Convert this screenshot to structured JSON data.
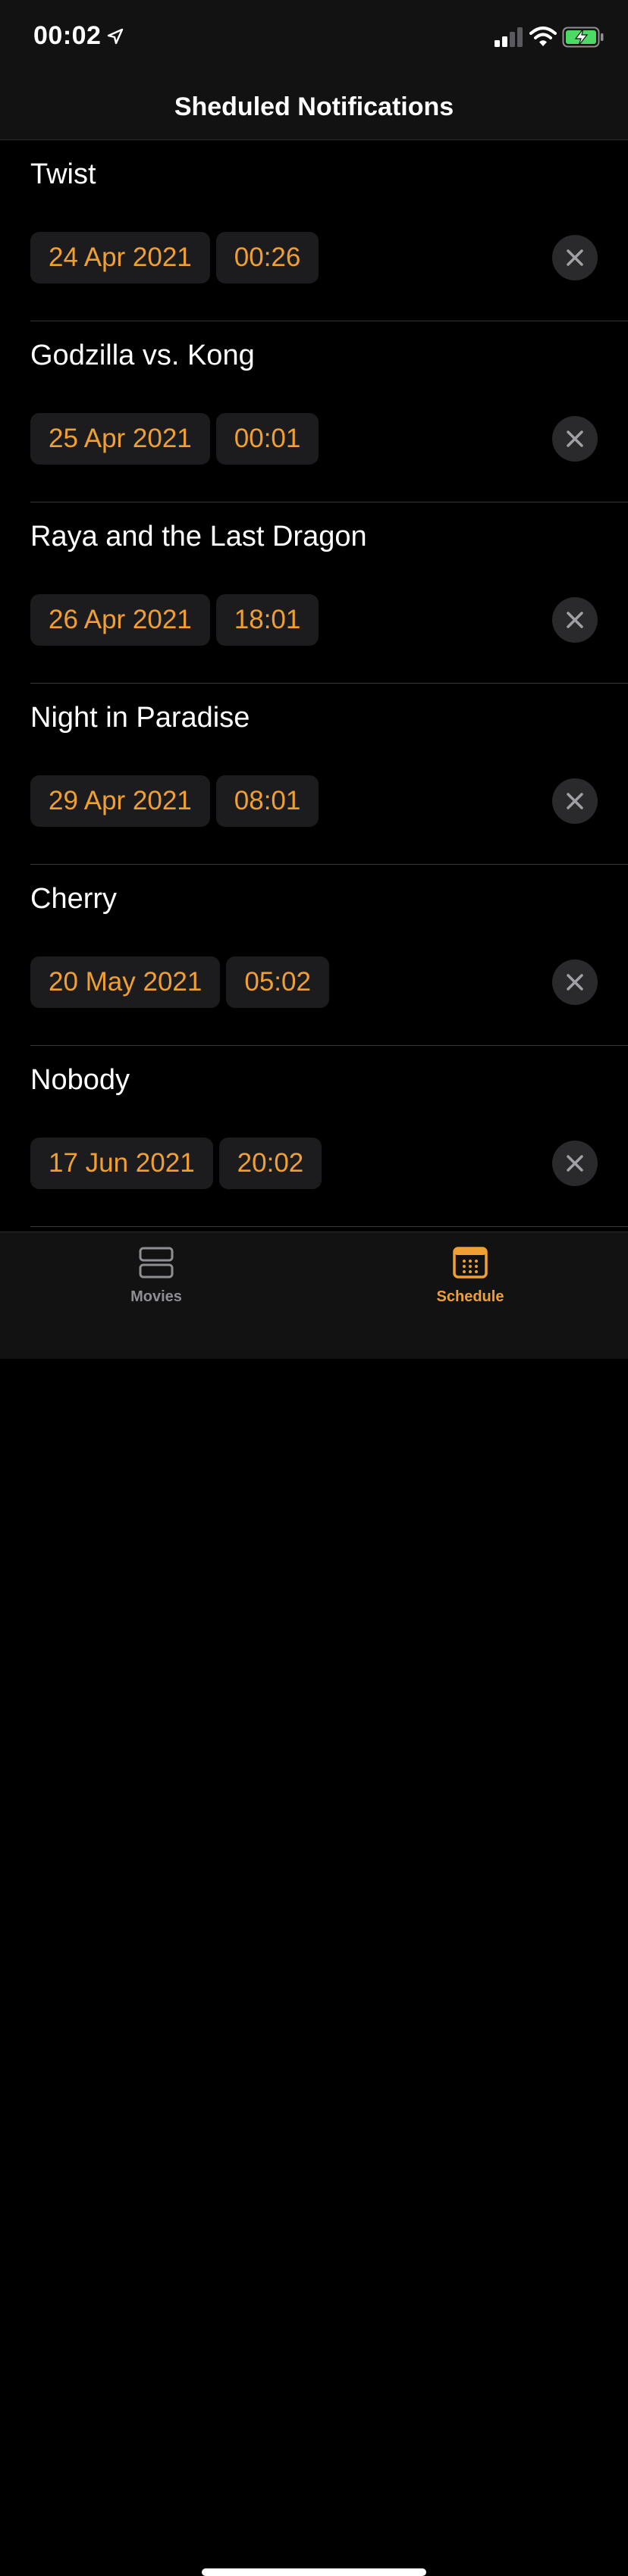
{
  "status_bar": {
    "time": "00:02"
  },
  "nav": {
    "title": "Sheduled Notifications"
  },
  "notifications": [
    {
      "title": "Twist",
      "date": "24 Apr 2021",
      "time": "00:26"
    },
    {
      "title": "Godzilla vs. Kong",
      "date": "25 Apr 2021",
      "time": "00:01"
    },
    {
      "title": "Raya and the Last Dragon",
      "date": "26 Apr 2021",
      "time": "18:01"
    },
    {
      "title": "Night in Paradise",
      "date": "29 Apr 2021",
      "time": "08:01"
    },
    {
      "title": "Cherry",
      "date": "20 May 2021",
      "time": "05:02"
    },
    {
      "title": "Nobody",
      "date": "17 Jun 2021",
      "time": "20:02"
    }
  ],
  "tab_bar": {
    "movies_label": "Movies",
    "schedule_label": "Schedule",
    "active_tab": "Schedule"
  },
  "colors": {
    "accent": "#f0a032",
    "inactive": "#8e8e93",
    "background": "#000000",
    "bar_background": "#121212",
    "pill_background": "#1c1c1e",
    "battery_fill": "#4cd964"
  },
  "icons": {
    "status": [
      "location-arrow-icon",
      "cellular-signal-icon",
      "wifi-icon",
      "battery-charging-icon"
    ],
    "row_action": "close-icon",
    "tabs": [
      "rows-icon",
      "calendar-icon"
    ]
  }
}
